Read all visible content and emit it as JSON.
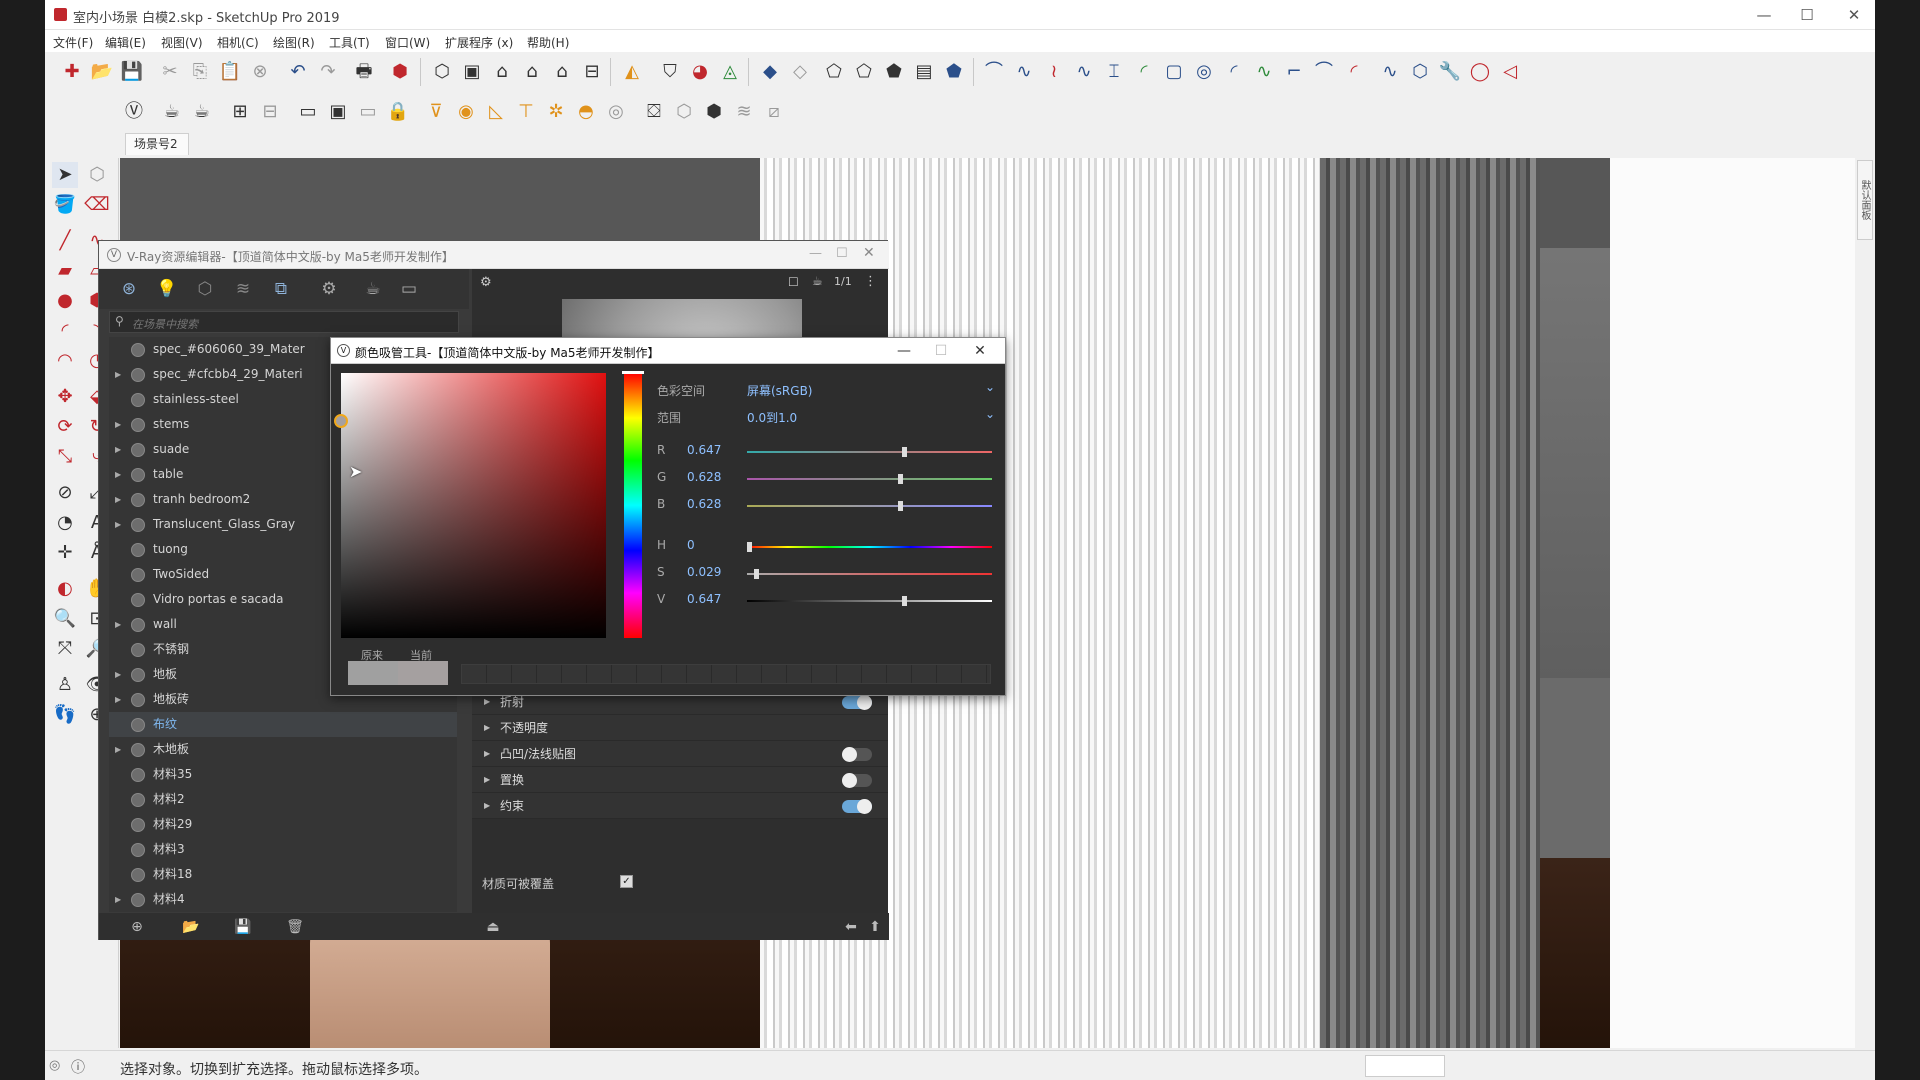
{
  "window": {
    "title": "室内小场景 白模2.skp - SketchUp Pro 2019",
    "minimize": "—",
    "maximize": "☐",
    "close": "✕"
  },
  "menu": [
    "文件(F)",
    "编辑(E)",
    "视图(V)",
    "相机(C)",
    "绘图(R)",
    "工具(T)",
    "窗口(W)",
    "扩展程序 (x)",
    "帮助(H)"
  ],
  "scene_tab": "场景号2",
  "side_panel_tab": "默认面板",
  "status": {
    "text": "选择对象。切换到扩充选择。拖动鼠标选择多项。"
  },
  "vray_editor": {
    "title": "V-Ray资源编辑器-【顶道简体中文版-by Ma5老师开发制作】",
    "search_placeholder": "在场景中搜索",
    "materials": [
      {
        "name": "spec_#606060_39_Mater",
        "expand": false
      },
      {
        "name": "spec_#cfcbb4_29_Materi",
        "expand": true
      },
      {
        "name": "stainless-steel",
        "expand": false
      },
      {
        "name": "stems",
        "expand": true
      },
      {
        "name": "suade",
        "expand": true
      },
      {
        "name": "table",
        "expand": true
      },
      {
        "name": "tranh bedroom2",
        "expand": true
      },
      {
        "name": "Translucent_Glass_Gray",
        "expand": true
      },
      {
        "name": "tuong",
        "expand": false
      },
      {
        "name": "TwoSided",
        "expand": false
      },
      {
        "name": "Vidro portas e sacada",
        "expand": false
      },
      {
        "name": "wall",
        "expand": true
      },
      {
        "name": "不锈钢",
        "expand": false
      },
      {
        "name": "地板",
        "expand": true
      },
      {
        "name": "地板砖",
        "expand": true
      },
      {
        "name": "布纹",
        "expand": false,
        "selected": true
      },
      {
        "name": "木地板",
        "expand": true
      },
      {
        "name": "材料35",
        "expand": false
      },
      {
        "name": "材料2",
        "expand": false
      },
      {
        "name": "材料29",
        "expand": false
      },
      {
        "name": "材料3",
        "expand": false
      },
      {
        "name": "材料18",
        "expand": false
      },
      {
        "name": "材料4",
        "expand": true
      }
    ],
    "properties": [
      {
        "label": "折射",
        "toggle": "on"
      },
      {
        "label": "不透明度",
        "toggle": "none"
      },
      {
        "label": "凸凹/法线贴图",
        "toggle": "off"
      },
      {
        "label": "置换",
        "toggle": "off"
      },
      {
        "label": "约束",
        "toggle": "on"
      }
    ],
    "override_label": "材质可被覆盖",
    "override_checked": "✓",
    "preview_counter": "1/1"
  },
  "color_picker": {
    "title": "颜色吸管工具-【顶道简体中文版-by Ma5老师开发制作】",
    "color_space_label": "色彩空间",
    "color_space_value": "屏幕(sRGB)",
    "range_label": "范围",
    "range_value": "0.0到1.0",
    "channels": [
      {
        "label": "R",
        "value": "0.647",
        "level": 0.647
      },
      {
        "label": "G",
        "value": "0.628",
        "level": 0.628
      },
      {
        "label": "B",
        "value": "0.628",
        "level": 0.628
      },
      {
        "label": "H",
        "value": "0",
        "level": 0.0
      },
      {
        "label": "S",
        "value": "0.029",
        "level": 0.029
      },
      {
        "label": "V",
        "value": "0.647",
        "level": 0.647
      }
    ],
    "original_label": "原来",
    "current_label": "当前"
  },
  "colors": {
    "accent": "#8ec0ff",
    "sketchup_red": "#c0272d",
    "picked": "#a5a0a0"
  }
}
